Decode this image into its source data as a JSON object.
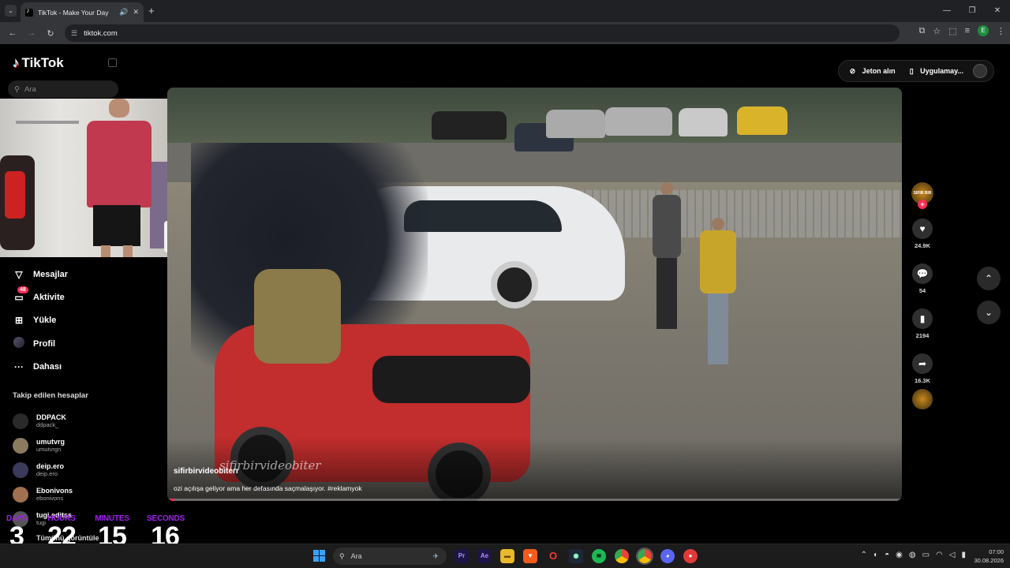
{
  "browser": {
    "tab_title": "TikTok - Make Your Day",
    "url": "tiktok.com",
    "profile_initial": "E"
  },
  "sidebar": {
    "brand": "TikTok",
    "search_placeholder": "Ara",
    "nav": [
      {
        "label": "Mesajlar",
        "icon": "send-icon"
      },
      {
        "label": "Aktivite",
        "icon": "inbox-icon",
        "badge": "48"
      },
      {
        "label": "Yükle",
        "icon": "upload-icon"
      },
      {
        "label": "Profil",
        "icon": "profile-avatar"
      },
      {
        "label": "Dahası",
        "icon": "more-icon"
      }
    ],
    "following_title": "Takip edilen hesaplar",
    "following": [
      {
        "name": "DDPACK",
        "user": "ddpack_"
      },
      {
        "name": "umutvrg",
        "user": "umutvrgn"
      },
      {
        "name": "deip.ero",
        "user": "deip.ero"
      },
      {
        "name": "Ebonivons",
        "user": "ebonivons"
      },
      {
        "name": "tugi.editss",
        "user": "tugi"
      }
    ],
    "see_more": "Tümünü görüntüle"
  },
  "header": {
    "coins": "Jeton alın",
    "app": "Uygulamay..."
  },
  "video": {
    "username": "sifirbirvideobiterr",
    "description": "ozi açılışa geliyor ama her defasında saçmalaşıyor. #reklamyok",
    "watermark": "sifirbirvideobiter",
    "progress": 0.01
  },
  "actions": {
    "avatar_text": "SIFIR BIR",
    "likes": "24.9K",
    "comments": "54",
    "saves": "2194",
    "shares": "16.3K"
  },
  "countdown": {
    "days_label": "DAYS",
    "days": "3",
    "hours_label": "HOURS",
    "hours": "22",
    "minutes_label": "MINUTES",
    "minutes": "15",
    "seconds_label": "SECONDS",
    "seconds": "16",
    "label_color": "#a020f0"
  },
  "taskbar": {
    "search": "Ara",
    "time": "07:00",
    "date": "30.08.2026"
  }
}
